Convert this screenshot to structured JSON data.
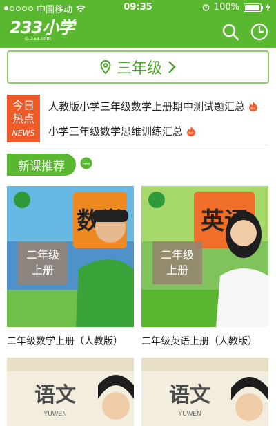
{
  "status": {
    "carrier": "中国移动",
    "time": "09:35",
    "battery": "100%"
  },
  "appbar": {
    "logo": "233小学",
    "logo_sub": "G.233.com"
  },
  "grade_selector": {
    "label": "三年级"
  },
  "news": {
    "badge_line1": "今日",
    "badge_line2": "热点",
    "badge_en": "NEWS",
    "items": [
      {
        "title": "人教版小学三年级数学上册期中测试题汇总"
      },
      {
        "title": "小学三年级数学思维训练汇总"
      }
    ]
  },
  "section": {
    "title": "新课推荐",
    "badge": "new"
  },
  "courses": [
    {
      "grade_line1": "二年级",
      "grade_line2": "上册",
      "title": "二年级数学上册（人教版）",
      "book_char": "数学"
    },
    {
      "grade_line1": "二年级",
      "grade_line2": "上册",
      "title": "二年级英语上册（人教版）",
      "book_char": "英语"
    },
    {
      "book_char": "语文",
      "book_pinyin": "YUWEN"
    },
    {
      "book_char": "语文",
      "book_pinyin": "YUWEN"
    }
  ],
  "colors": {
    "brand_green": "#5ab830",
    "news_red": "#f05a28"
  },
  "icons": {
    "search": "search-icon",
    "history": "clock-icon",
    "location": "location-pin-icon",
    "chevron": "chevron-right-icon"
  }
}
